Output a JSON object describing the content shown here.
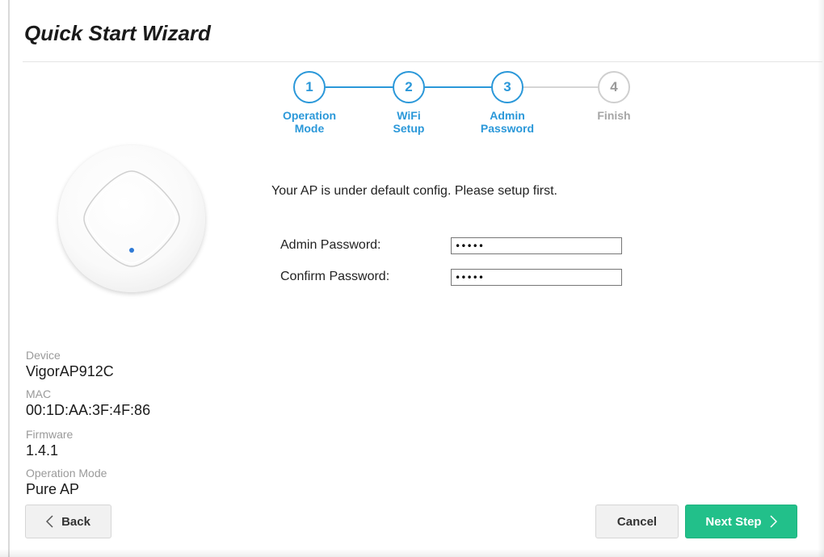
{
  "wizard": {
    "title": "Quick Start Wizard"
  },
  "steps": [
    {
      "number": "1",
      "line1": "Operation",
      "line2": "Mode",
      "state": "done"
    },
    {
      "number": "2",
      "line1": "WiFi",
      "line2": "Setup",
      "state": "done"
    },
    {
      "number": "3",
      "line1": "Admin",
      "line2": "Password",
      "state": "current"
    },
    {
      "number": "4",
      "line1": "Finish",
      "line2": "",
      "state": "pending"
    }
  ],
  "form": {
    "intro": "Your AP is under default config. Please setup first.",
    "admin_password_label": "Admin Password:",
    "admin_password_value": "12345",
    "confirm_password_label": "Confirm Password:",
    "confirm_password_value": "12345"
  },
  "device_info": {
    "device_label": "Device",
    "device_value": "VigorAP912C",
    "mac_label": "MAC",
    "mac_value": "00:1D:AA:3F:4F:86",
    "firmware_label": "Firmware",
    "firmware_value": "1.4.1",
    "mode_label": "Operation Mode",
    "mode_value": "Pure AP"
  },
  "buttons": {
    "back": "Back",
    "cancel": "Cancel",
    "next": "Next Step"
  },
  "colors": {
    "accent": "#2b98d9",
    "pending": "#cfcfcf",
    "next_button": "#22c08a"
  },
  "icons": {
    "back": "chevron-left-icon",
    "next": "chevron-right-icon",
    "led": "status-led-icon"
  }
}
